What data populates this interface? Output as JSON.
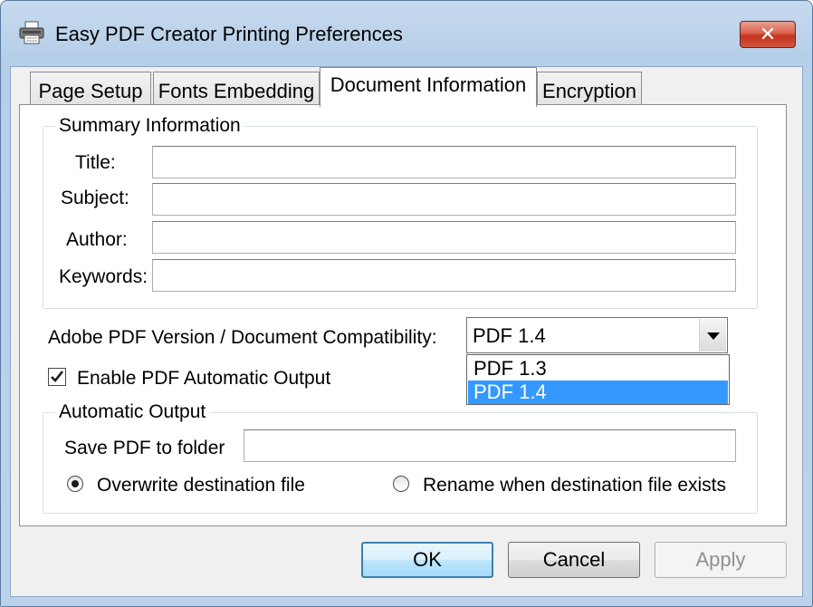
{
  "window": {
    "title": "Easy PDF Creator Printing Preferences",
    "close_label": "✕"
  },
  "tabs": [
    {
      "label": "Page Setup"
    },
    {
      "label": "Fonts Embedding"
    },
    {
      "label": "Document Information"
    },
    {
      "label": "Encryption"
    }
  ],
  "summary": {
    "legend": "Summary Information",
    "title_label": "Title:",
    "subject_label": "Subject:",
    "author_label": "Author:",
    "keywords_label": "Keywords:",
    "title_value": "",
    "subject_value": "",
    "author_value": "",
    "keywords_value": ""
  },
  "compat": {
    "label": "Adobe PDF Version / Document Compatibility:",
    "selected": "PDF 1.4",
    "options": [
      "PDF 1.3",
      "PDF 1.4"
    ]
  },
  "auto_enable": {
    "label": "Enable PDF Automatic Output",
    "checked": true
  },
  "auto_output": {
    "legend": "Automatic Output",
    "folder_label": "Save PDF to folder",
    "folder_value": "",
    "overwrite_label": "Overwrite destination file",
    "rename_label": "Rename when destination file exists"
  },
  "buttons": {
    "ok": "OK",
    "cancel": "Cancel",
    "apply": "Apply"
  }
}
